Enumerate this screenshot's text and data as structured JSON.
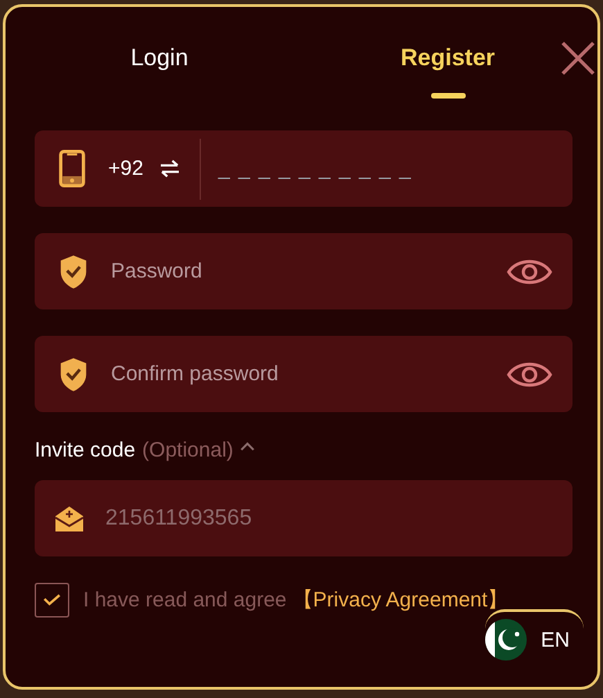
{
  "tabs": [
    {
      "label": "Login",
      "selected": false
    },
    {
      "label": "Register",
      "selected": true
    }
  ],
  "phone": {
    "country_code": "+92",
    "placeholder": "_ _ _ _ _ _ _ _ _ _"
  },
  "password": {
    "placeholder": "Password"
  },
  "confirm_password": {
    "placeholder": "Confirm password"
  },
  "invite": {
    "label": "Invite code",
    "optional": "(Optional)",
    "expanded": true,
    "value": "215611993565"
  },
  "agreement": {
    "checked": true,
    "text": "I have read and agree",
    "link": "【Privacy Agreement】"
  },
  "language": {
    "label": "EN"
  }
}
